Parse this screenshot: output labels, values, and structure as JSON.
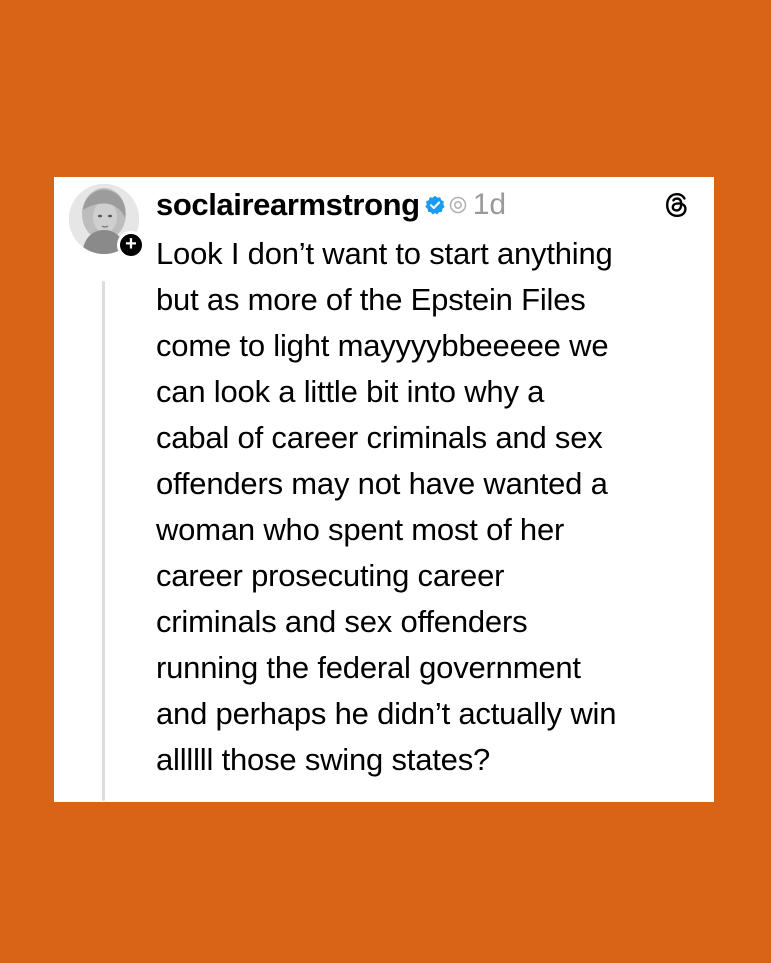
{
  "post": {
    "username": "soclairearmstrong",
    "time": "1d",
    "follow_symbol": "+",
    "text": "Look I don’t want to start anything\nbut as more of the Epstein Files\ncome to light mayyyybbeeeee we\ncan look a little bit into why a\ncabal of career criminals and sex\noffenders may not have wanted a\nwoman who spent most of her\ncareer prosecuting career\ncriminals and sex offenders\nrunning the federal government\nand perhaps he didn’t actually win\nallllll those swing states?"
  },
  "icons": {
    "verified": "verified-badge-icon",
    "threads_small": "threads-icon",
    "threads_logo": "threads-logo-icon"
  },
  "colors": {
    "background": "#D96415",
    "card": "#FFFFFF",
    "verified": "#1D9BF0",
    "muted": "#9A9A9A"
  }
}
